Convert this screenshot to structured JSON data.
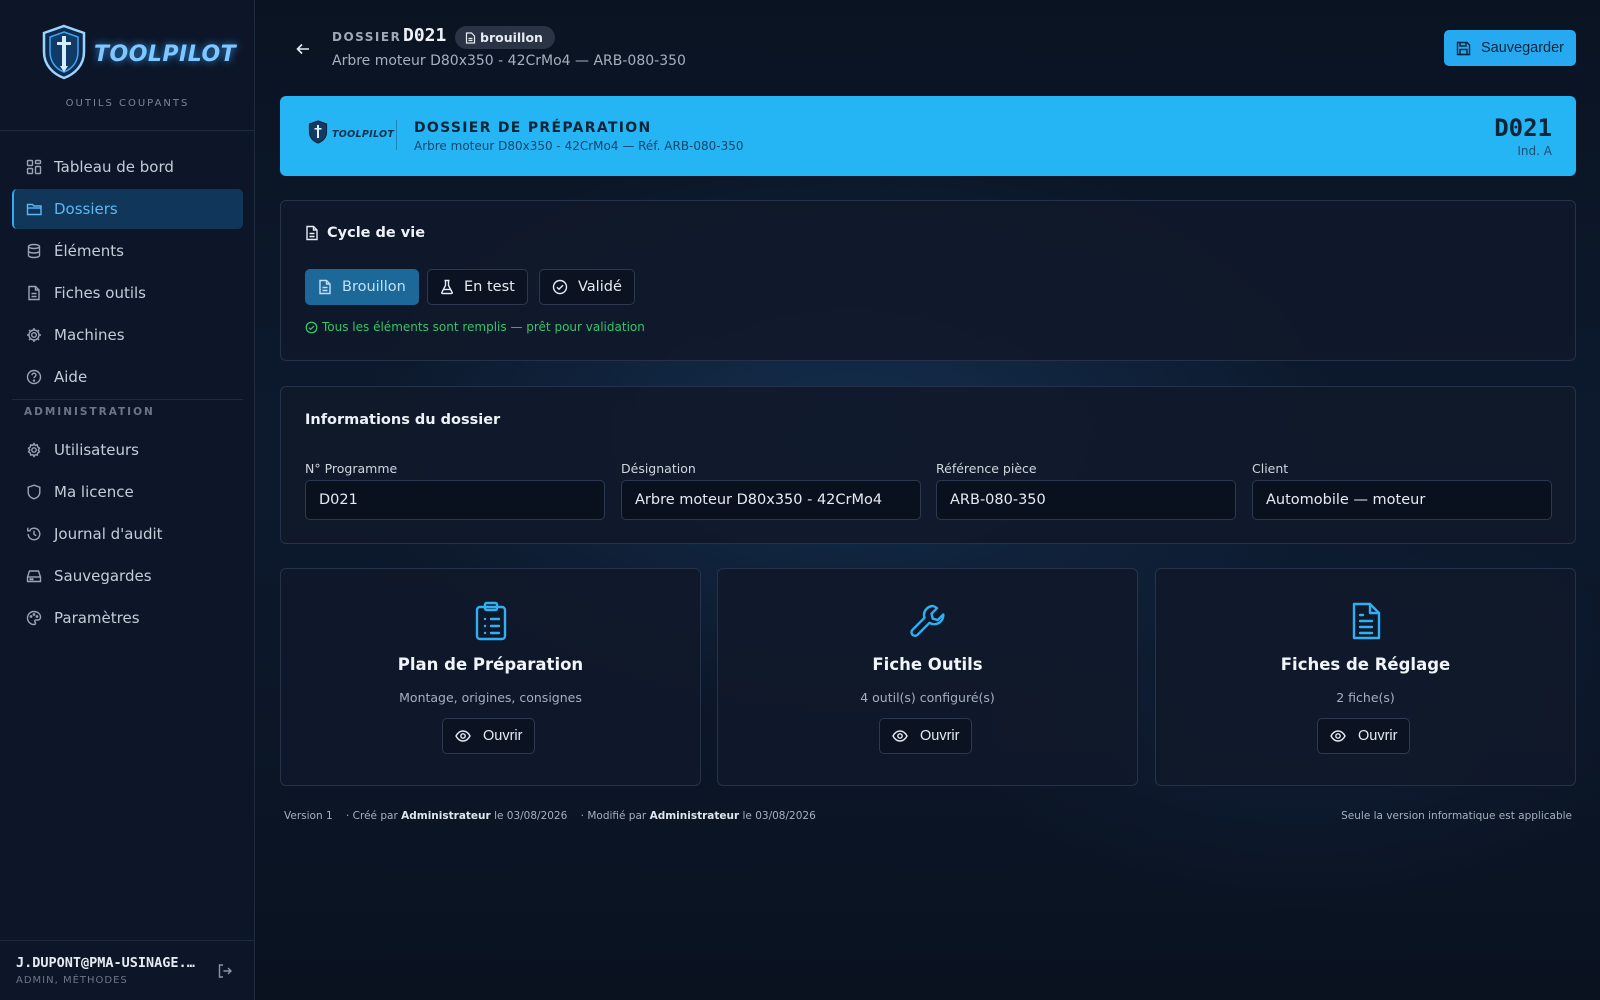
{
  "sidebar": {
    "logo_text": "TOOLPILOT",
    "logo_subtitle": "OUTILS COUPANTS",
    "items": [
      {
        "label": "Tableau de bord",
        "icon": "dashboard-icon"
      },
      {
        "label": "Dossiers",
        "icon": "folder-icon",
        "active": true
      },
      {
        "label": "Éléments",
        "icon": "database-icon"
      },
      {
        "label": "Fiches outils",
        "icon": "file-icon"
      },
      {
        "label": "Machines",
        "icon": "cog-icon"
      },
      {
        "label": "Aide",
        "icon": "help-icon"
      }
    ],
    "admin_section_label": "ADMINISTRATION",
    "admin_items": [
      {
        "label": "Utilisateurs",
        "icon": "gear-icon"
      },
      {
        "label": "Ma licence",
        "icon": "shield-icon"
      },
      {
        "label": "Journal d'audit",
        "icon": "history-icon"
      },
      {
        "label": "Sauvegardes",
        "icon": "drive-icon"
      },
      {
        "label": "Paramètres",
        "icon": "palette-icon"
      }
    ],
    "user": {
      "email": "J.DUPONT@PMA-USINAGE.FR",
      "role": "ADMIN, MÉTHODES"
    }
  },
  "header": {
    "label": "DOSSIER",
    "code": "D021",
    "status_badge": "brouillon",
    "subtitle": "Arbre moteur D80x350 - 42CrMo4 — ARB-080-350",
    "save_label": "Sauvegarder"
  },
  "banner": {
    "logo_text": "TOOLPILOT",
    "title": "DOSSIER DE PRÉPARATION",
    "subtitle": "Arbre moteur D80x350 - 42CrMo4 — Réf. ARB-080-350",
    "code": "D021",
    "index": "Ind. A"
  },
  "lifecycle": {
    "title": "Cycle de vie",
    "states": [
      {
        "label": "Brouillon",
        "icon": "document-icon",
        "active": true
      },
      {
        "label": "En test",
        "icon": "flask-icon",
        "active": false
      },
      {
        "label": "Validé",
        "icon": "check-circle-icon",
        "active": false
      }
    ],
    "message": "Tous les éléments sont remplis — prêt pour validation"
  },
  "info": {
    "title": "Informations du dossier",
    "fields": [
      {
        "label": "N° Programme",
        "value": "D021"
      },
      {
        "label": "Désignation",
        "value": "Arbre moteur D80x350 - 42CrMo4"
      },
      {
        "label": "Référence pièce",
        "value": "ARB-080-350"
      },
      {
        "label": "Client",
        "value": "Automobile — moteur"
      }
    ]
  },
  "tiles": [
    {
      "title": "Plan de Préparation",
      "subtitle": "Montage, origines, consignes",
      "button": "Ouvrir",
      "icon": "clipboard-list-icon"
    },
    {
      "title": "Fiche Outils",
      "subtitle": "4 outil(s) configuré(s)",
      "button": "Ouvrir",
      "icon": "wrench-icon"
    },
    {
      "title": "Fiches de Réglage",
      "subtitle": "2 fiche(s)",
      "button": "Ouvrir",
      "icon": "file-text-icon"
    }
  ],
  "footer": {
    "version": "Version 1",
    "created_prefix": "· Créé par",
    "created_by": "Administrateur",
    "created_on": "le 03/08/2026",
    "modified_prefix": "· Modifié par",
    "modified_by": "Administrateur",
    "modified_on": "le 03/08/2026",
    "notice": "Seule la version informatique est applicable"
  },
  "colors": {
    "accent": "#26b5f4",
    "success": "#34c46a",
    "background": "#0b1424"
  }
}
